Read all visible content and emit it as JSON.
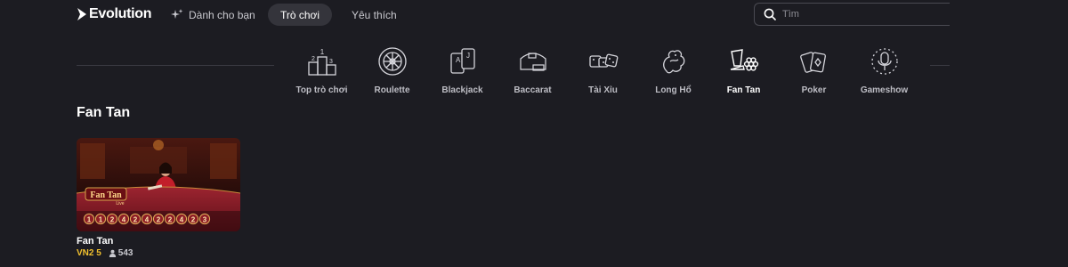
{
  "header": {
    "logo_text": "Evolution",
    "nav": {
      "for_you": "Dành cho bạn",
      "games": "Trò chơi",
      "favorites": "Yêu thích"
    },
    "search": {
      "placeholder": "Tìm",
      "value": ""
    }
  },
  "categories": [
    {
      "label": "Top trò chơi",
      "icon": "podium-icon"
    },
    {
      "label": "Roulette",
      "icon": "roulette-wheel-icon"
    },
    {
      "label": "Blackjack",
      "icon": "playing-cards-icon"
    },
    {
      "label": "Baccarat",
      "icon": "baccarat-table-icon"
    },
    {
      "label": "Tài Xỉu",
      "icon": "dice-icon"
    },
    {
      "label": "Long Hổ",
      "icon": "dragon-icon"
    },
    {
      "label": "Fan Tan",
      "icon": "fan-tan-cup-icon",
      "active": true
    },
    {
      "label": "Poker",
      "icon": "poker-cards-icon"
    },
    {
      "label": "Gameshow",
      "icon": "microphone-icon"
    }
  ],
  "section": {
    "title": "Fan Tan",
    "games": [
      {
        "name": "Fan Tan",
        "bet": "VN2 5",
        "players": "543",
        "thumbnail": {
          "logo": "Fan Tan",
          "logo_sub": "Live",
          "results": [
            "1",
            "1",
            "2",
            "4",
            "2",
            "4",
            "2",
            "2",
            "4",
            "2",
            "3"
          ]
        }
      }
    ]
  },
  "colors": {
    "background": "#1c1c22",
    "active_pill": "#34343b",
    "bet_accent": "#f2c12e",
    "thumb_table": "#8e1d26"
  }
}
